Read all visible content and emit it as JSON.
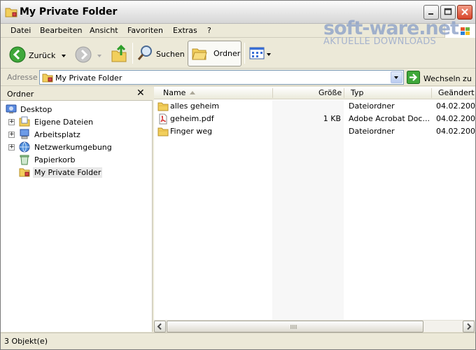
{
  "window": {
    "title": "My Private Folder"
  },
  "watermark": {
    "logo": "soft-ware.net",
    "sub": "AKTUELLE DOWNLOADS"
  },
  "menu": [
    "Datei",
    "Bearbeiten",
    "Ansicht",
    "Favoriten",
    "Extras",
    "?"
  ],
  "toolbar": {
    "back": "Zurück",
    "search": "Suchen",
    "folders": "Ordner"
  },
  "address": {
    "label": "Adresse",
    "value": "My Private Folder",
    "go": "Wechseln zu"
  },
  "folder_pane": {
    "title": "Ordner",
    "close": "✕",
    "tree": [
      {
        "label": "Desktop",
        "icon": "desktop-icon",
        "expander": false
      },
      {
        "label": "Eigene Dateien",
        "icon": "my-documents-icon",
        "expander": true
      },
      {
        "label": "Arbeitsplatz",
        "icon": "my-computer-icon",
        "expander": true
      },
      {
        "label": "Netzwerkumgebung",
        "icon": "network-icon",
        "expander": true
      },
      {
        "label": "Papierkorb",
        "icon": "recycle-bin-icon",
        "expander": false
      },
      {
        "label": "My Private Folder",
        "icon": "private-folder-icon",
        "expander": false,
        "selected": true
      }
    ]
  },
  "file_list": {
    "columns": {
      "name": "Name",
      "size": "Größe",
      "type": "Typ",
      "modified": "Geändert"
    },
    "rows": [
      {
        "name": "alles geheim",
        "size": "",
        "type": "Dateiordner",
        "modified": "04.02.200",
        "icon": "folder-icon"
      },
      {
        "name": "geheim.pdf",
        "size": "1 KB",
        "type": "Adobe Acrobat Doc...",
        "modified": "04.02.200",
        "icon": "pdf-icon"
      },
      {
        "name": "Finger weg",
        "size": "",
        "type": "Dateiordner",
        "modified": "04.02.200",
        "icon": "folder-icon"
      }
    ]
  },
  "status": {
    "text": "3 Objekt(e)"
  }
}
